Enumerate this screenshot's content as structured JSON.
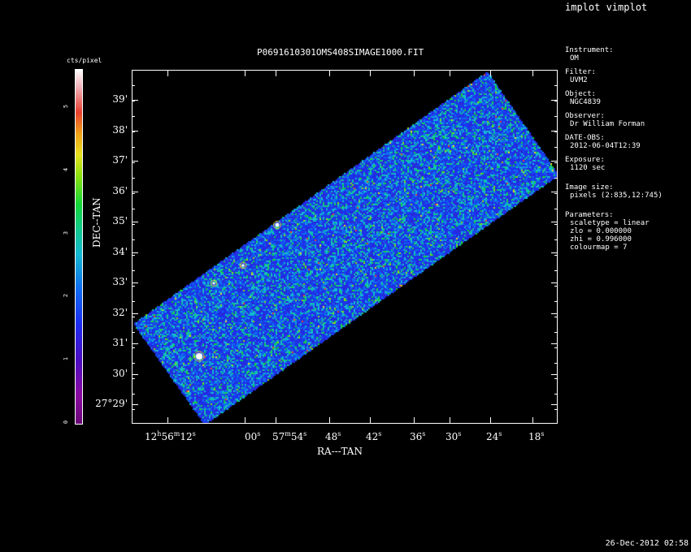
{
  "window_title": "implot vimplot",
  "plot": {
    "title": "P0691610301OMS408SIMAGE1000.FIT",
    "xlabel": "RA---TAN",
    "ylabel": "DEC--TAN",
    "y_ticks": [
      "39'",
      "38'",
      "37'",
      "36'",
      "35'",
      "34'",
      "33'",
      "32'",
      "31'",
      "30'",
      "27°29'"
    ],
    "x_ticks": [
      "12h56m12s",
      "00s",
      "57m54s",
      "48s",
      "42s",
      "36s",
      "30s",
      "24s",
      "18s"
    ]
  },
  "colorbar": {
    "label": "cts/pixel",
    "ticks": [
      "0",
      "1",
      "2",
      "3",
      "4",
      "5"
    ]
  },
  "info": {
    "instrument_label": "Instrument:",
    "instrument": "OM",
    "filter_label": "Filter:",
    "filter": "UVM2",
    "object_label": "Object:",
    "object": "NGC4839",
    "observer_label": "Observer:",
    "observer": "Dr William Forman",
    "date_label": "DATE-OBS:",
    "date": "2012-06-04T12:39",
    "exposure_label": "Exposure:",
    "exposure": "1120 sec",
    "image_size_label": "Image size:",
    "image_size": "pixels (2:835,12:745)",
    "parameters_label": "Parameters:",
    "parameters": [
      "scaletype = linear",
      "zlo = 0.000000",
      "zhi = 0.996000",
      "colourmap =  7"
    ]
  },
  "footer_date": "26-Dec-2012 02:58"
}
